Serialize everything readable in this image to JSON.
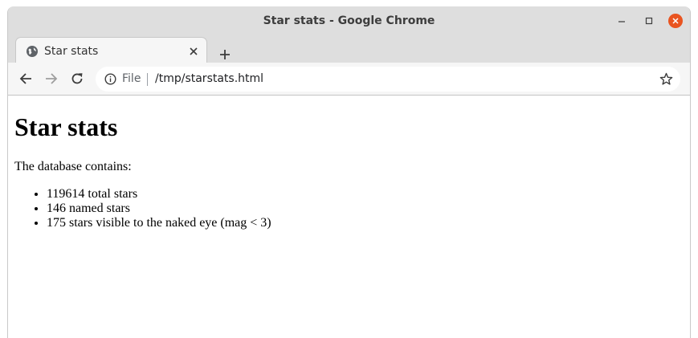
{
  "window": {
    "title": "Star stats - Google Chrome"
  },
  "tab": {
    "title": "Star stats"
  },
  "omnibox": {
    "scheme_label": "File",
    "url": "/tmp/starstats.html"
  },
  "page": {
    "heading": "Star stats",
    "intro": "The database contains:",
    "stats": [
      "119614 total stars",
      "146 named stars",
      "175 stars visible to the naked eye (mag < 3)"
    ]
  },
  "colors": {
    "titlebar": "#dedede",
    "close_button": "#e95420",
    "toolbar": "#f6f6f6"
  },
  "icons": {
    "tab": "globe-icon",
    "tab_close": "close-icon",
    "new_tab": "plus-icon",
    "back": "arrow-left-icon",
    "forward": "arrow-right-icon",
    "reload": "reload-icon",
    "info": "info-icon",
    "bookmark": "star-icon"
  }
}
